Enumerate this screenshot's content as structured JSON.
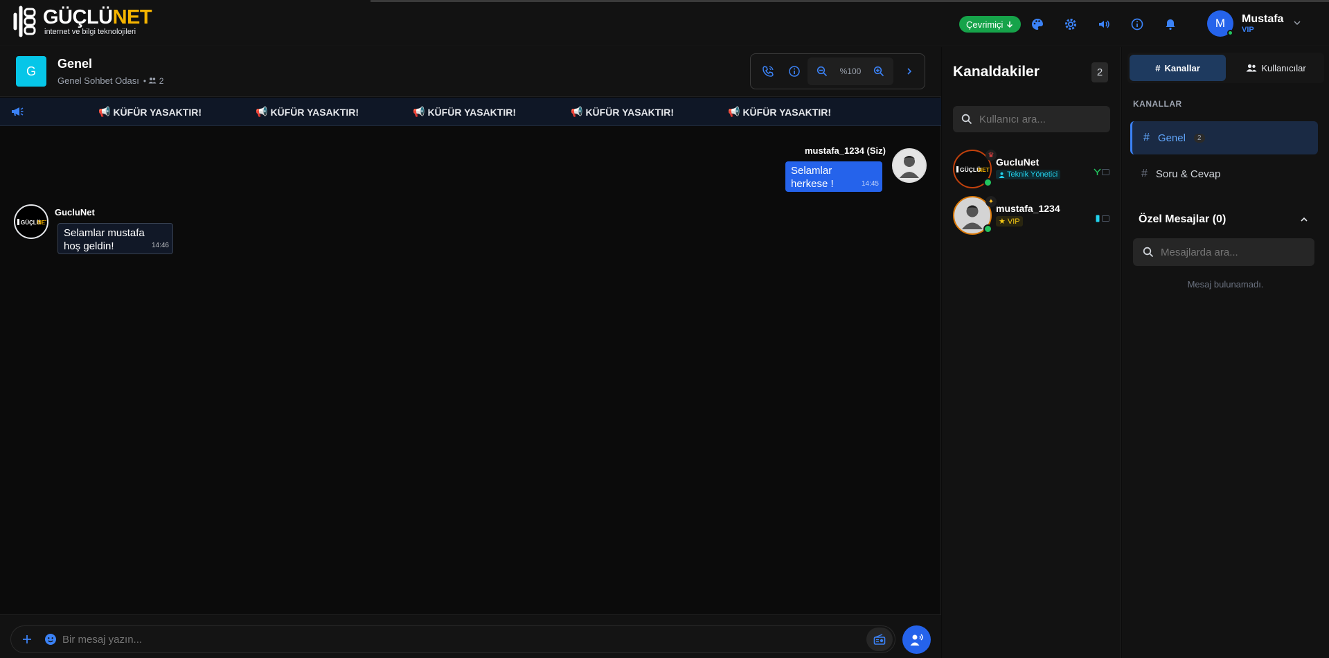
{
  "brand": {
    "name_main": "GÜÇLÜ",
    "name_accent": "NET",
    "tagline": "internet ve bilgi teknolojileri"
  },
  "topbar": {
    "status": "Çevrimiçi",
    "icons": [
      "palette-icon",
      "settings-icon",
      "volume-icon",
      "info-icon",
      "bell-icon"
    ],
    "user": {
      "initial": "M",
      "name": "Mustafa",
      "rank": "VIP"
    }
  },
  "room": {
    "badge": "G",
    "name": "Genel",
    "subtitle": "Genel Sohbet Odası",
    "member_count": "2",
    "zoom": "%100"
  },
  "ticker": {
    "items": [
      "KÜFÜR YASAKTIR!",
      "KÜFÜR YASAKTIR!",
      "KÜFÜR YASAKTIR!",
      "KÜFÜR YASAKTIR!",
      "KÜFÜR YASAKTIR!"
    ]
  },
  "messages": [
    {
      "sender": "mustafa_1234 (Siz)",
      "line1": "Selamlar",
      "line2": "herkese !",
      "time": "14:45"
    },
    {
      "sender": "GucluNet",
      "line1": "Selamlar mustafa",
      "line2": "hoş geldin!",
      "time": "14:46"
    }
  ],
  "composer": {
    "placeholder": "Bir mesaj yazın..."
  },
  "members": {
    "title": "Kanaldakiler",
    "count": "2",
    "search_placeholder": "Kullanıcı ara...",
    "list": [
      {
        "name": "GucluNet",
        "role": "Teknik Yönetici"
      },
      {
        "name": "mustafa_1234",
        "role": "VIP"
      }
    ]
  },
  "sidebar": {
    "tab_channels": "Kanallar",
    "tab_users": "Kullanıcılar",
    "section": "KANALLAR",
    "channels": [
      {
        "name": "Genel",
        "count": "2"
      },
      {
        "name": "Soru & Cevap"
      }
    ],
    "pm_title": "Özel Mesajlar (0)",
    "pm_search_placeholder": "Mesajlarda ara...",
    "pm_empty": "Mesaj bulunamadı."
  },
  "colors": {
    "accent": "#3b82f6",
    "online": "#22c55e",
    "brand_accent": "#f5b400",
    "room_badge": "#06c6e8"
  }
}
